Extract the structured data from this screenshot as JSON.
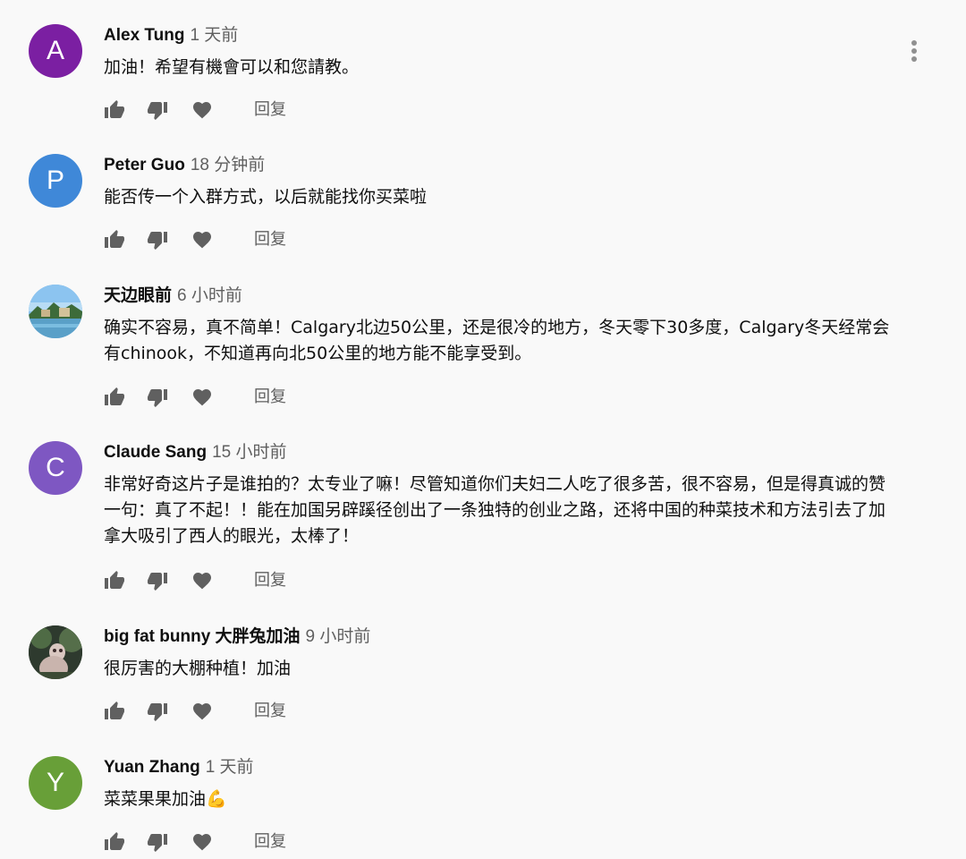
{
  "comments": [
    {
      "author": "Alex Tung",
      "time": "1 天前",
      "text": "加油！希望有機會可以和您請教。",
      "avatar_letter": "A",
      "avatar_color": "#7b1fa2",
      "reply_label": "回复"
    },
    {
      "author": "Peter Guo",
      "time": "18 分钟前",
      "text": "能否传一个入群方式，以后就能找你买菜啦",
      "avatar_letter": "P",
      "avatar_color": "#3f88d8",
      "reply_label": "回复"
    },
    {
      "author": "天边眼前",
      "time": "6 小时前",
      "text": "确实不容易，真不简单！Calgary北边50公里，还是很冷的地方，冬天零下30多度，Calgary冬天经常会有chinook，不知道再向北50公里的地方能不能享受到。",
      "avatar_letter": "",
      "avatar_color": "#7fb3e6",
      "reply_label": "回复"
    },
    {
      "author": "Claude Sang",
      "time": "15 小时前",
      "text": "非常好奇这片子是谁拍的？太专业了嘛！尽管知道你们夫妇二人吃了很多苦，很不容易，但是得真诚的赞一句：真了不起！！能在加国另辟蹊径创出了一条独特的创业之路，还将中国的种菜技术和方法引去了加拿大吸引了西人的眼光，太棒了！",
      "avatar_letter": "C",
      "avatar_color": "#7e57c2",
      "reply_label": "回复"
    },
    {
      "author": "big fat bunny 大胖兔加油",
      "time": "9 小时前",
      "text": "很厉害的大棚种植！加油",
      "avatar_letter": "",
      "avatar_color": "#3a4a3a",
      "reply_label": "回复"
    },
    {
      "author": "Yuan Zhang",
      "time": "1 天前",
      "text": "菜菜果果加油💪",
      "avatar_letter": "Y",
      "avatar_color": "#689f38",
      "reply_label": "回复"
    }
  ]
}
